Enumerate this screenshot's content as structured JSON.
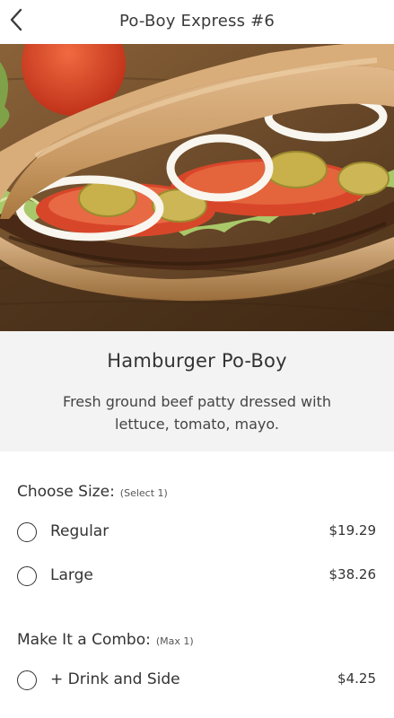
{
  "header": {
    "title": "Po-Boy Express #6",
    "back_icon": "chevron-left-icon"
  },
  "item": {
    "title": "Hamburger Po-Boy",
    "description": "Fresh ground beef patty dressed with lettuce, tomato, mayo."
  },
  "sections": [
    {
      "title": "Choose Size:",
      "note": "(Select 1)",
      "options": [
        {
          "label": "Regular",
          "price": "$19.29"
        },
        {
          "label": "Large",
          "price": "$38.26"
        }
      ]
    },
    {
      "title": "Make It a Combo:",
      "note": "(Max 1)",
      "options": [
        {
          "label": "+ Drink and Side",
          "price": "$4.25"
        }
      ]
    }
  ]
}
